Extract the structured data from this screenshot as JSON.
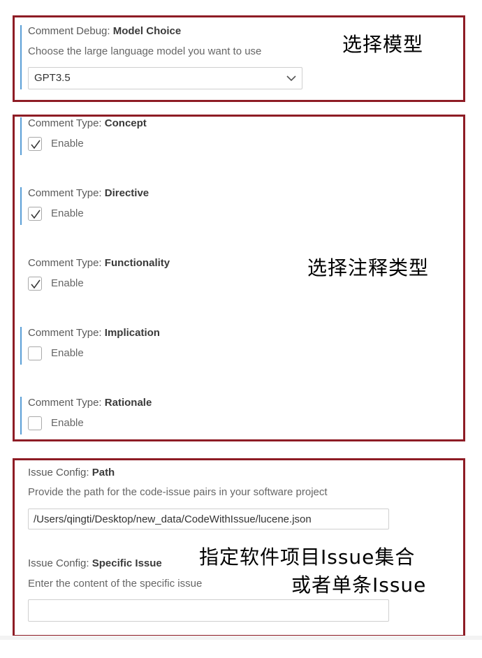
{
  "model_section": {
    "title_prefix": "Comment Debug:",
    "title_name": "Model Choice",
    "description": "Choose the large language model you want to use",
    "selected_model": "GPT3.5",
    "annotation": "选择模型"
  },
  "comment_types": {
    "title_prefix": "Comment Type:",
    "enable_label": "Enable",
    "annotation": "选择注释类型",
    "items": [
      {
        "name": "Concept",
        "checked": true
      },
      {
        "name": "Directive",
        "checked": true
      },
      {
        "name": "Functionality",
        "checked": true
      },
      {
        "name": "Implication",
        "checked": false
      },
      {
        "name": "Rationale",
        "checked": false
      }
    ]
  },
  "issue_config": {
    "path": {
      "title_prefix": "Issue Config:",
      "title_name": "Path",
      "description": "Provide the path for the code-issue pairs in your software project",
      "value": "/Users/qingti/Desktop/new_data/CodeWithIssue/lucene.json"
    },
    "specific_issue": {
      "title_prefix": "Issue Config:",
      "title_name": "Specific Issue",
      "description": "Enter the content of the specific issue",
      "value": ""
    },
    "annotation_line1": "指定软件项目Issue集合",
    "annotation_line2": "或者单条Issue"
  },
  "colors": {
    "frame": "#8e1c25",
    "accent": "#5a9fd6"
  }
}
